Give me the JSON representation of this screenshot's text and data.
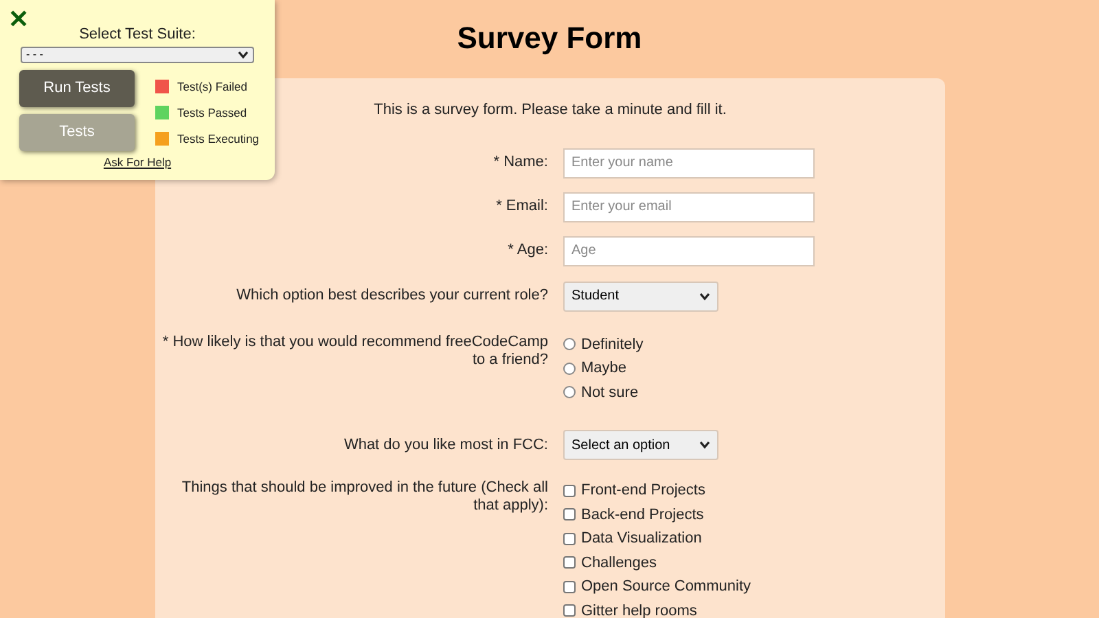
{
  "test_panel": {
    "close_glyph": "✕",
    "suite_label": "Select Test Suite:",
    "suite_value": "- - -",
    "buttons": [
      {
        "label": "Run Tests",
        "kind": "primary"
      },
      {
        "label": "Tests",
        "kind": "secondary"
      }
    ],
    "legend": [
      {
        "label": "Test(s) Failed",
        "color": "#f0544a"
      },
      {
        "label": "Tests Passed",
        "color": "#5fd35f"
      },
      {
        "label": "Tests Executing",
        "color": "#f5a01e"
      }
    ],
    "help_link": "Ask For Help"
  },
  "title": "Survey Form",
  "intro": "This is a survey form. Please take a minute and fill it.",
  "fields": [
    {
      "kind": "text",
      "label": "* Name:",
      "placeholder": "Enter your name"
    },
    {
      "kind": "text",
      "label": "* Email:",
      "placeholder": "Enter your email"
    },
    {
      "kind": "text",
      "label": "* Age:",
      "placeholder": "Age"
    },
    {
      "kind": "select",
      "label": "Which option best describes your current role?",
      "value": "Student"
    },
    {
      "kind": "radio",
      "label": "* How likely is that you would recommend freeCodeCamp to a friend?",
      "options": [
        {
          "label": "Definitely",
          "selected": false
        },
        {
          "label": "Maybe",
          "selected": false
        },
        {
          "label": "Not sure",
          "selected": false
        }
      ]
    },
    {
      "kind": "select",
      "label": "What do you like most in FCC:",
      "value": "Select an option"
    },
    {
      "kind": "checkbox",
      "label": "Things that should be improved in the future (Check all that apply):",
      "options": [
        {
          "label": "Front-end Projects",
          "checked": false
        },
        {
          "label": "Back-end Projects",
          "checked": false
        },
        {
          "label": "Data Visualization",
          "checked": false
        },
        {
          "label": "Challenges",
          "checked": false
        },
        {
          "label": "Open Source Community",
          "checked": false
        },
        {
          "label": "Gitter help rooms",
          "checked": false
        }
      ]
    }
  ]
}
